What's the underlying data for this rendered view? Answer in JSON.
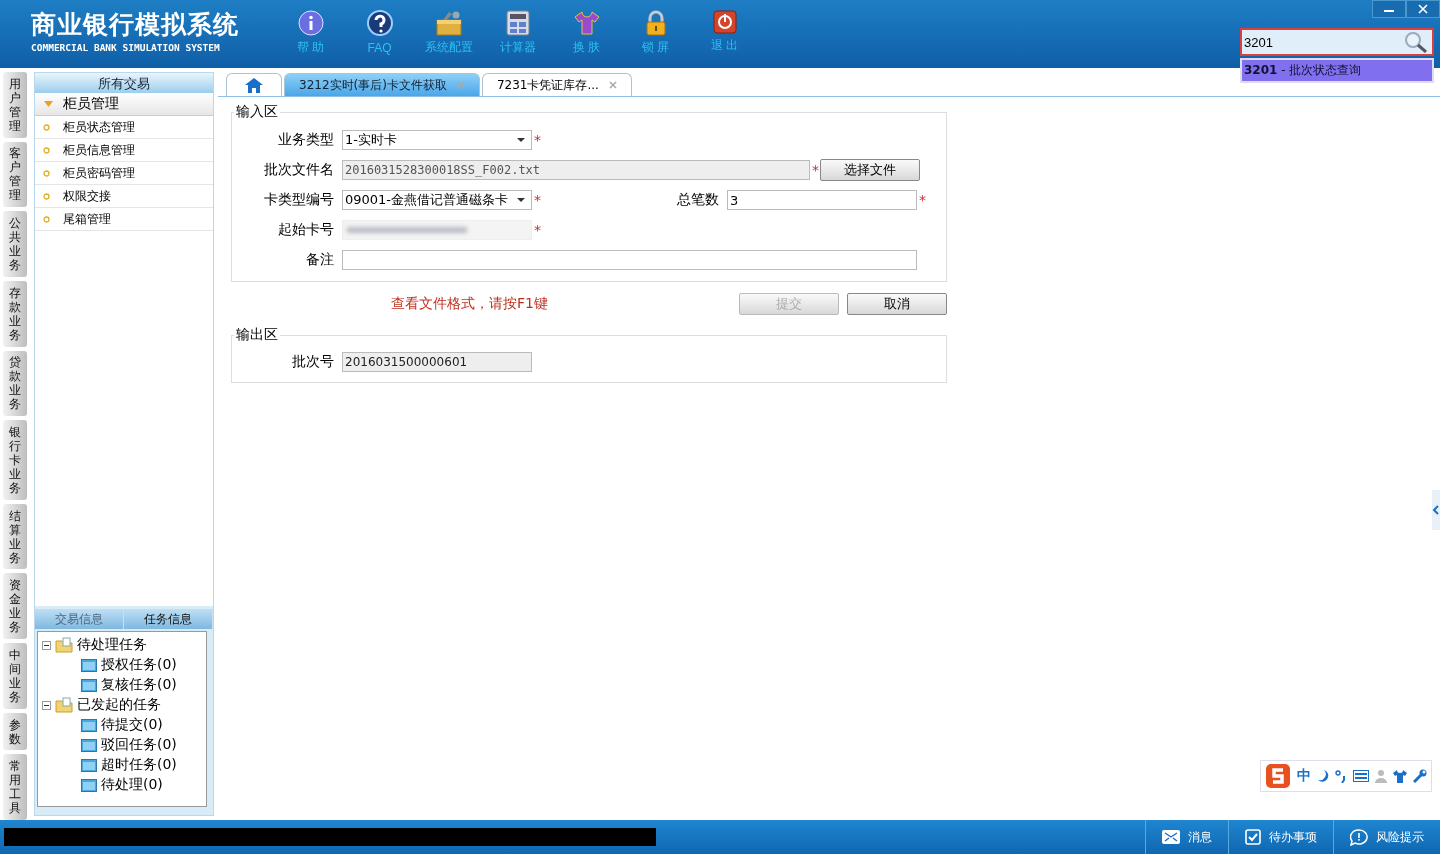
{
  "header": {
    "title": "商业银行模拟系统",
    "subtitle": "COMMERCIAL BANK SIMULATION SYSTEM",
    "toolbar": [
      {
        "label": "帮 助",
        "kind": "info"
      },
      {
        "label": "FAQ",
        "kind": "faq"
      },
      {
        "label": "系统配置",
        "kind": "config"
      },
      {
        "label": "计算器",
        "kind": "calc"
      },
      {
        "label": "换 肤",
        "kind": "skin"
      },
      {
        "label": "锁 屏",
        "kind": "lock"
      },
      {
        "label": "退 出",
        "kind": "exit"
      }
    ]
  },
  "search": {
    "value": "3201",
    "suggestion": "**3201** - 批次状态查询"
  },
  "left_tabs": [
    "用户管理",
    "客户管理",
    "公共业务",
    "存款业务",
    "贷款业务",
    "银行卡业务",
    "结算业务",
    "资金业务",
    "中间业务",
    "参数",
    "常用工具"
  ],
  "sidebar": {
    "header": "所有交易",
    "group": {
      "label": "柜员管理",
      "expanded": true,
      "items": [
        "柜员状态管理",
        "柜员信息管理",
        "柜员密码管理",
        "权限交接",
        "尾箱管理"
      ]
    }
  },
  "info_tabs": [
    {
      "label": "交易信息",
      "selected": false
    },
    {
      "label": "任务信息",
      "selected": true
    }
  ],
  "tree": [
    {
      "label": "待处理任务",
      "expanded": true,
      "children": [
        {
          "label": "授权任务(0)"
        },
        {
          "label": "复核任务(0)"
        }
      ]
    },
    {
      "label": "已发起的任务",
      "expanded": true,
      "children": [
        {
          "label": "待提交(0)"
        },
        {
          "label": "驳回任务(0)"
        },
        {
          "label": "超时任务(0)"
        },
        {
          "label": "待处理(0)"
        }
      ]
    }
  ],
  "tabs": [
    {
      "kind": "home",
      "selected": false
    },
    {
      "kind": "page",
      "label": "3212实时(事后)卡文件获取",
      "selected": true
    },
    {
      "kind": "page",
      "label": "7231卡凭证库存...",
      "selected": false
    }
  ],
  "input_area": {
    "legend": "输入区",
    "rows": [
      [
        {
          "label": "业务类型",
          "kind": "select",
          "value": "1-实时卡",
          "required_mark": "*"
        }
      ],
      [
        {
          "label": "批次文件名",
          "kind": "file",
          "value": "2016031528300018SS_F002.txt",
          "required_mark": "*",
          "button": "选择文件"
        }
      ],
      [
        {
          "label": "卡类型编号",
          "kind": "select",
          "value": "09001-金燕借记普通磁条卡",
          "required_mark": "*"
        },
        {
          "label": "总笔数",
          "kind": "text-right",
          "value": "3",
          "required_mark": "*"
        }
      ],
      [
        {
          "label": "起始卡号",
          "kind": "masked",
          "required_mark": "*"
        }
      ],
      [
        {
          "label": "备注",
          "kind": "text-wide"
        }
      ]
    ]
  },
  "hint": "查看文件格式，请按F1键",
  "buttons": [
    {
      "label": "提交",
      "disabled": true
    },
    {
      "label": "取消",
      "disabled": false
    }
  ],
  "output_area": {
    "legend": "输出区",
    "fields": [
      {
        "label": "批次号",
        "value": "2016031500000601"
      }
    ]
  },
  "ime": {
    "label": "中"
  },
  "status_bar": [
    {
      "label": "消息",
      "kind": "mail"
    },
    {
      "label": "待办事项",
      "kind": "todo"
    },
    {
      "label": "风险提示",
      "kind": "risk"
    }
  ]
}
